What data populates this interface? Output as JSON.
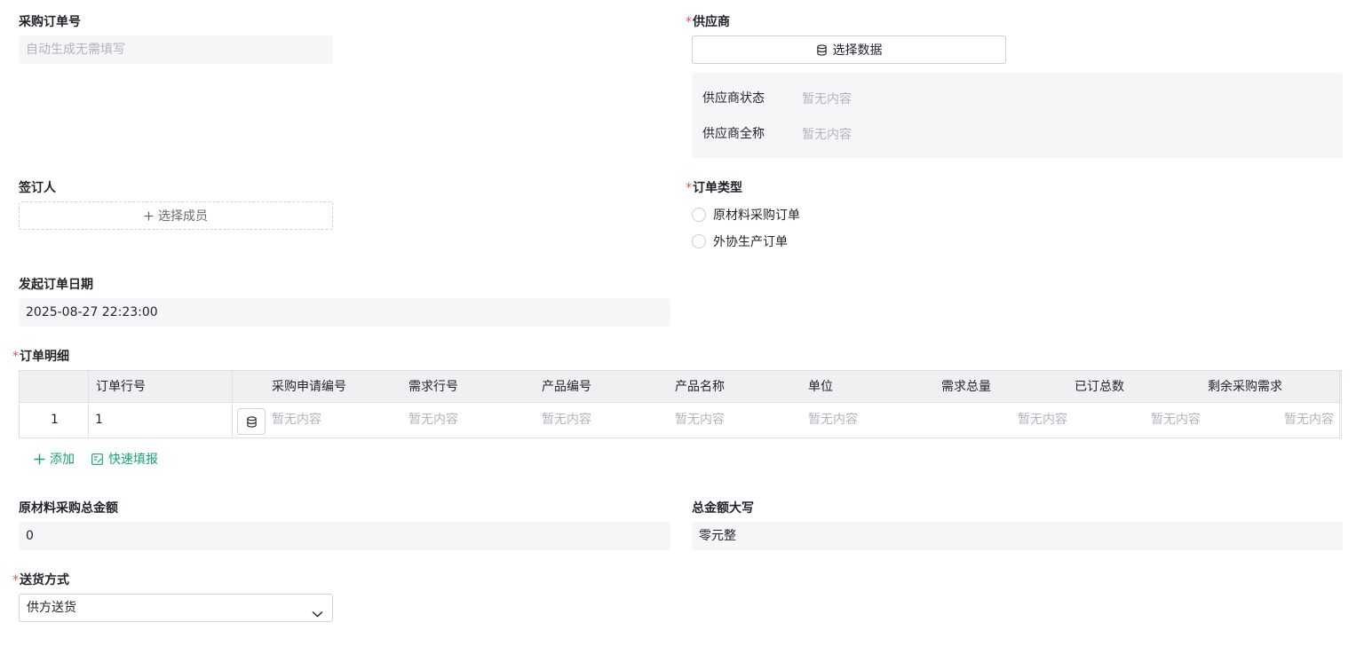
{
  "po_number": {
    "label": "采购订单号",
    "placeholder": "自动生成无需填写"
  },
  "supplier": {
    "required": "*",
    "label": "供应商",
    "select_button": "选择数据",
    "status_label": "供应商状态",
    "status_value": "暂无内容",
    "fullname_label": "供应商全称",
    "fullname_value": "暂无内容"
  },
  "signer": {
    "label": "签订人",
    "add_button": "选择成员"
  },
  "order_type": {
    "required": "*",
    "label": "订单类型",
    "options": [
      "原材料采购订单",
      "外协生产订单"
    ]
  },
  "order_date": {
    "label": "发起订单日期",
    "value": "2025-08-27 22:23:00"
  },
  "order_details": {
    "required": "*",
    "label": "订单明细",
    "columns": [
      "订单行号",
      "采购申请编号",
      "需求行号",
      "产品编号",
      "产品名称",
      "单位",
      "需求总量",
      "已订总数",
      "剩余采购需求"
    ],
    "rows": [
      {
        "index": "1",
        "line_no": "1",
        "request_no": "暂无内容",
        "demand_line": "暂无内容",
        "product_code": "暂无内容",
        "product_name": "暂无内容",
        "unit": "暂无内容",
        "total_demand": "暂无内容",
        "ordered_total": "暂无内容",
        "remaining": "暂无内容"
      }
    ],
    "add_label": "添加",
    "quick_fill_label": "快速填报"
  },
  "total_amount": {
    "label": "原材料采购总金额",
    "value": "0"
  },
  "amount_capital": {
    "label": "总金额大写",
    "value": "零元整"
  },
  "delivery": {
    "required": "*",
    "label": "送货方式",
    "value": "供方送货"
  },
  "colors": {
    "accent": "#15a374",
    "required": "#f54a45",
    "placeholder": "#b0b4bb",
    "field_bg": "#f5f6f7"
  }
}
